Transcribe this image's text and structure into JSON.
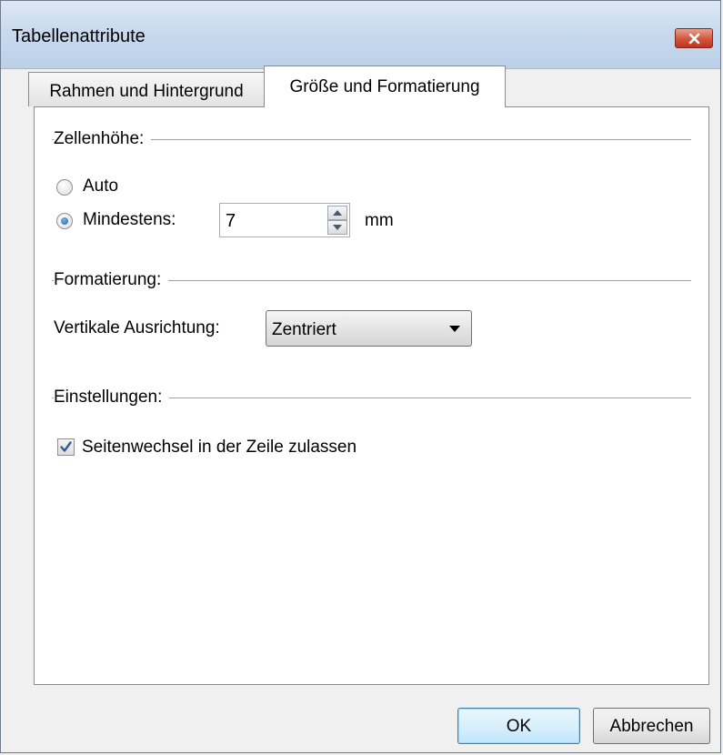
{
  "window": {
    "title": "Tabellenattribute",
    "close_icon": "close-icon"
  },
  "tabs": [
    {
      "label": "Rahmen und Hintergrund",
      "active": false
    },
    {
      "label": "Größe und Formatierung",
      "active": true
    }
  ],
  "cell_height": {
    "section_title": "Zellenhöhe:",
    "option_auto": "Auto",
    "option_min": "Mindestens:",
    "selected": "Mindestens:",
    "min_value": "7",
    "unit": "mm"
  },
  "formatting": {
    "section_title": "Formatierung:",
    "vertical_align_label": "Vertikale Ausrichtung:",
    "vertical_align_value": "Zentriert"
  },
  "settings": {
    "section_title": "Einstellungen:",
    "allow_page_break_label": "Seitenwechsel in der Zeile zulassen",
    "allow_page_break_checked": true
  },
  "buttons": {
    "ok": "OK",
    "cancel": "Abbrechen"
  },
  "colors": {
    "close_button": "#c2331e",
    "ok_button_border": "#3c7fb1",
    "radio_dot": "#1f5e9c"
  }
}
